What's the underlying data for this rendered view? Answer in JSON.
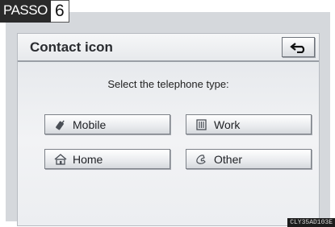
{
  "step": {
    "label": "PASSO",
    "number": "6"
  },
  "header": {
    "title": "Contact icon"
  },
  "back_button": {
    "icon": "return-arrow-icon"
  },
  "instruction": "Select the telephone type:",
  "types": {
    "mobile": {
      "label": "Mobile",
      "icon": "mobile-phone-icon"
    },
    "work": {
      "label": "Work",
      "icon": "building-icon"
    },
    "home": {
      "label": "Home",
      "icon": "house-icon"
    },
    "other": {
      "label": "Other",
      "icon": "handset-icon"
    }
  },
  "image_code": "CLY35AD103E",
  "colors": {
    "panel": "#eceef1",
    "button_border": "#7c8188",
    "badge": "#2a2a2a"
  }
}
